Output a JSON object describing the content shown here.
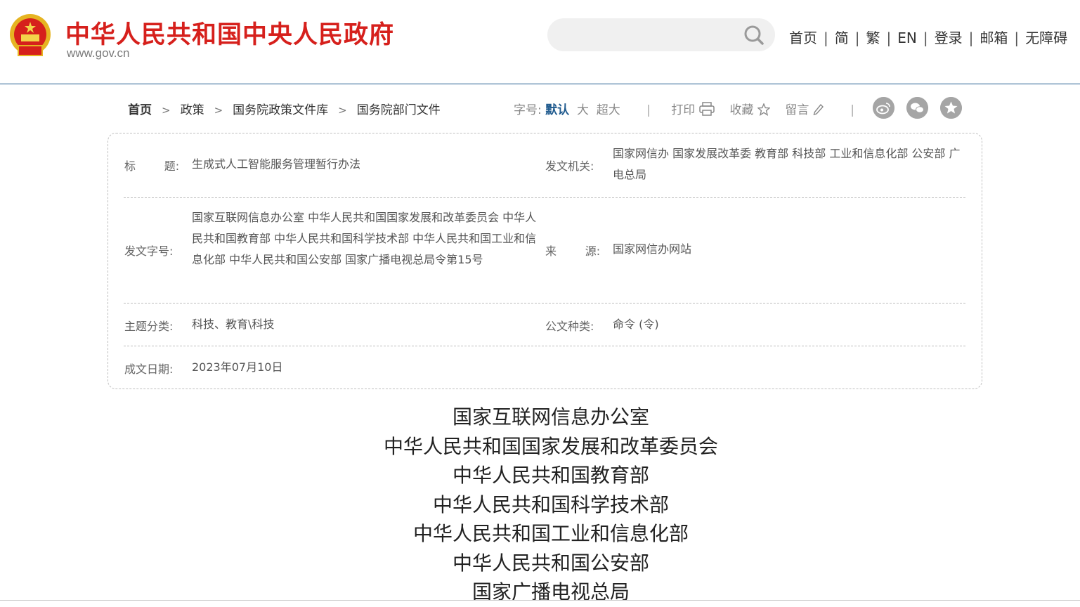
{
  "site": {
    "title": "中华人民共和国中央人民政府",
    "url": "www.gov.cn"
  },
  "search": {
    "placeholder": ""
  },
  "topnav": [
    "首页",
    "简",
    "繁",
    "EN",
    "登录",
    "邮箱",
    "无障碍"
  ],
  "breadcrumb": [
    "首页",
    "政策",
    "国务院政策文件库",
    "国务院部门文件"
  ],
  "tools": {
    "font_label": "字号:",
    "font_default": "默认",
    "font_large": "大",
    "font_xlarge": "超大",
    "print": "打印",
    "favorite": "收藏",
    "comment": "留言"
  },
  "share_icons": [
    "weibo-icon",
    "wechat-icon",
    "favorite-star-icon"
  ],
  "info": {
    "title_label": "标        题:",
    "title_value": "生成式人工智能服务管理暂行办法",
    "issuer_label": "发文机关:",
    "issuer_value": "国家网信办  国家发展改革委  教育部  科技部  工业和信息化部  公安部  广电总局",
    "docno_label": "发文字号:",
    "docno_value": "国家互联网信息办公室  中华人民共和国国家发展和改革委员会  中华人民共和国教育部  中华人民共和国科学技术部  中华人民共和国工业和信息化部  中华人民共和国公安部  国家广播电视总局令第15号",
    "source_label": "来        源:",
    "source_value": "国家网信办网站",
    "topic_label": "主题分类:",
    "topic_value": "科技、教育\\科技",
    "type_label": "公文种类:",
    "type_value": "命令 (令)",
    "date_label": "成文日期:",
    "date_value": "2023年07月10日"
  },
  "document": {
    "issuers": [
      "国家互联网信息办公室",
      "中华人民共和国国家发展和改革委员会",
      "中华人民共和国教育部",
      "中华人民共和国科学技术部",
      "中华人民共和国工业和信息化部",
      "中华人民共和国公安部",
      "国家广播电视总局"
    ]
  },
  "colors": {
    "brand_red": "#d6201c",
    "link_blue": "#1f5a8e"
  }
}
